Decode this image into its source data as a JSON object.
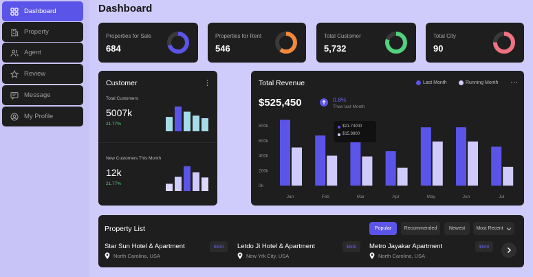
{
  "sidebar": {
    "items": [
      {
        "label": "Dashboard",
        "icon": "grid-icon"
      },
      {
        "label": "Property",
        "icon": "building-icon"
      },
      {
        "label": "Agent",
        "icon": "users-icon"
      },
      {
        "label": "Review",
        "icon": "star-icon"
      },
      {
        "label": "Message",
        "icon": "message-icon"
      },
      {
        "label": "My Profile",
        "icon": "user-circle-icon"
      }
    ]
  },
  "page": {
    "title": "Dashboard"
  },
  "stats": [
    {
      "label": "Properties for Sale",
      "value": "684",
      "color": "#5b54e8",
      "fraction": 0.7
    },
    {
      "label": "Properties for Rent",
      "value": "546",
      "color": "#f1883c",
      "fraction": 0.6
    },
    {
      "label": "Total Customer",
      "value": "5,732",
      "color": "#52d27e",
      "fraction": 0.8
    },
    {
      "label": "Total City",
      "value": "90",
      "color": "#f07282",
      "fraction": 0.75
    }
  ],
  "customer": {
    "title": "Customer",
    "total_label": "Total Customers",
    "total_value": "5007k",
    "total_pct": "21.77%",
    "total_bars": [
      0.55,
      0.95,
      0.75,
      0.6,
      0.5
    ],
    "new_label": "New Customers This Month",
    "new_value": "12k",
    "new_pct": "21.77%",
    "new_bars": [
      0.28,
      0.55,
      0.95,
      0.72,
      0.52
    ]
  },
  "revenue": {
    "title": "Total Revenue",
    "amount": "$525,450",
    "change": "0.8%",
    "change_note": "Than last Month",
    "legend_last": "Last Month",
    "legend_running": "Running Month",
    "tooltip_a": "$21.74000",
    "tooltip_b": "$15.9800",
    "colors": {
      "last": "#5b54e8",
      "running": "#cfcbfa"
    }
  },
  "chart_data": {
    "type": "bar",
    "title": "Total Revenue",
    "categories": [
      "Jan",
      "Feb",
      "Mar",
      "Apr",
      "May",
      "Jun",
      "Jul"
    ],
    "yticks": [
      "800k",
      "600k",
      "400k",
      "200k",
      "0k"
    ],
    "ylim": [
      0,
      800
    ],
    "series": [
      {
        "name": "Last Month",
        "values": [
          880,
          670,
          620,
          460,
          780,
          780,
          520
        ]
      },
      {
        "name": "Running Month",
        "values": [
          510,
          400,
          390,
          240,
          590,
          590,
          250
        ]
      }
    ]
  },
  "property_list": {
    "title": "Property List",
    "tabs": [
      "Popular",
      "Recommended",
      "Newest",
      "Most Recent"
    ],
    "items": [
      {
        "name": "Star Sun Hotel & Apartment",
        "location": "North Carolina, USA",
        "price": "$500"
      },
      {
        "name": "Letdo Ji Hotel & Apartment",
        "location": "New Yrk City, USA",
        "price": "$500"
      },
      {
        "name": "Metro Jayakar Apartment",
        "location": "North Carolina, USA",
        "price": "$500"
      }
    ]
  }
}
